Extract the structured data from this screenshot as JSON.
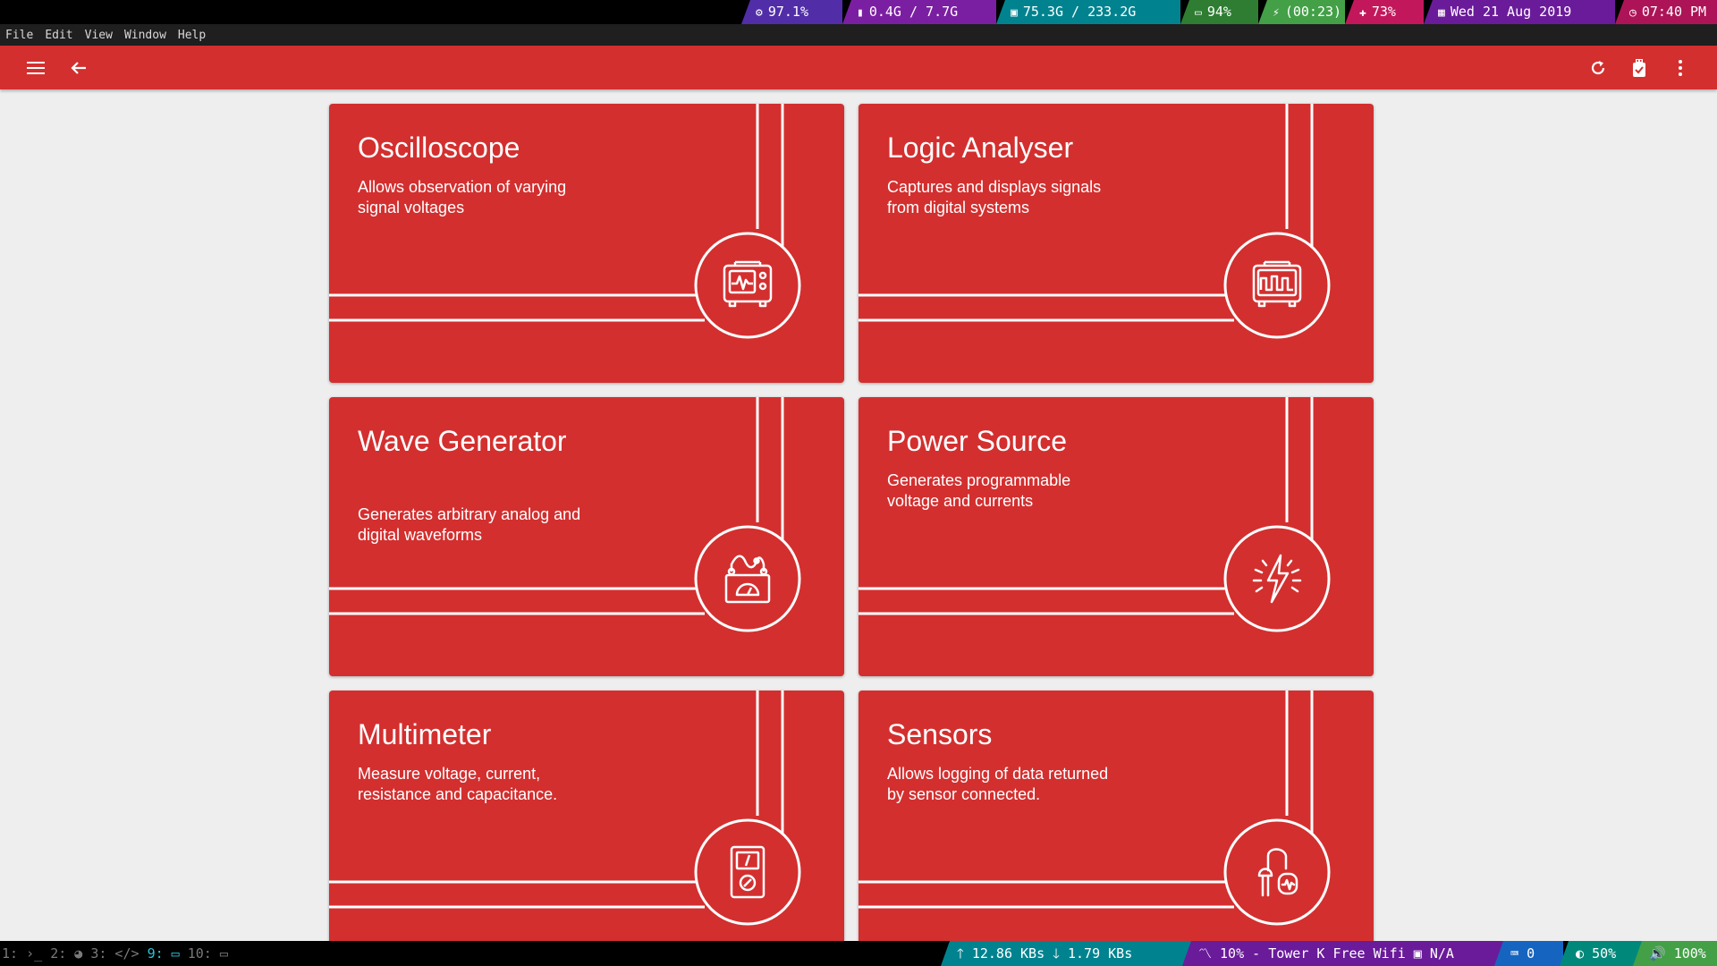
{
  "status_top": {
    "cpu": "97.1%",
    "memory": "0.4G / 7.7G",
    "disk": "75.3G / 233.2G",
    "battery": "94%",
    "charge_time": "(00:23)",
    "brightness": "73%",
    "date": "Wed 21 Aug 2019",
    "time": "07:40 PM"
  },
  "menubar": {
    "file": "File",
    "edit": "Edit",
    "view": "View",
    "window": "Window",
    "help": "Help"
  },
  "toolbar": {
    "menu_icon": "hamburger-icon",
    "back_icon": "arrow-left-icon",
    "refresh_icon": "refresh-icon",
    "device_icon": "usb-device-icon",
    "more_icon": "more-vert-icon"
  },
  "colors": {
    "primary": "#d32f2f",
    "background": "#eeeeee"
  },
  "cards": [
    {
      "title": "Oscilloscope",
      "description": "Allows observation of varying signal voltages",
      "icon": "oscilloscope-icon"
    },
    {
      "title": "Logic Analyser",
      "description": "Captures and displays signals from digital systems",
      "icon": "logic-analyser-icon"
    },
    {
      "title": "Wave Generator",
      "description": "Generates arbitrary analog and digital waveforms",
      "icon": "wave-generator-icon"
    },
    {
      "title": "Power Source",
      "description": "Generates programmable voltage and currents",
      "icon": "power-source-icon"
    },
    {
      "title": "Multimeter",
      "description": "Measure voltage, current, resistance and capacitance.",
      "icon": "multimeter-icon"
    },
    {
      "title": "Sensors",
      "description": "Allows logging of data returned by sensor connected.",
      "icon": "sensors-icon"
    }
  ],
  "status_bot": {
    "workspaces": [
      "1:",
      "2:",
      "3:",
      "9:",
      "10:"
    ],
    "upload": "12.86 KBs",
    "download": "1.79 KBs",
    "wifi": "10% - Tower K Free Wifi",
    "ethernet": "N/A",
    "keyboard": "0",
    "display": "50%",
    "volume": "100%"
  }
}
